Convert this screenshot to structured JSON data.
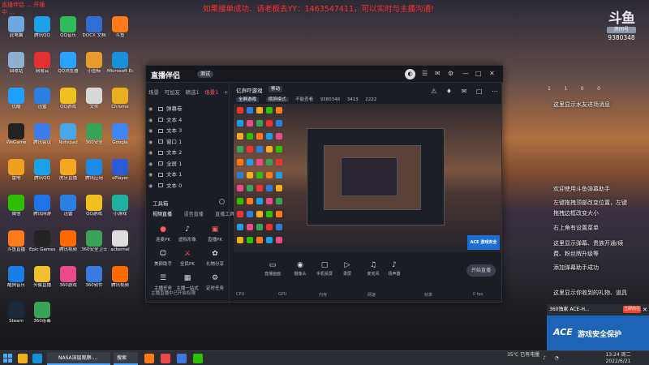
{
  "desktop_notice": "如果搜单成功、请老板去YY：1463547411，可以实时与主播沟通!",
  "corner_overlay_text": "直播伴侣 ... 开播中 ...",
  "douyu_badge": {
    "logo": "斗鱼",
    "sub": "房间号",
    "room": "9380348"
  },
  "desktop_icons": [
    {
      "label": "此电脑",
      "color": "#6fa8e0"
    },
    {
      "label": "腾讯QQ",
      "color": "#1aa1e8"
    },
    {
      "label": "QQ音乐",
      "color": "#2dbb5e"
    },
    {
      "label": "DOCX 文档",
      "color": "#2f6fd1"
    },
    {
      "label": "斗鱼",
      "color": "#ff7a1a"
    },
    {
      "label": "回收站",
      "color": "#8fb0d0"
    },
    {
      "label": "网易云",
      "color": "#e33030"
    },
    {
      "label": "QQ浏览器",
      "color": "#29a3ff"
    },
    {
      "label": "小图标",
      "color": "#e89a2c"
    },
    {
      "label": "Microsoft Edge",
      "color": "#1690d8"
    },
    {
      "label": "优酷",
      "color": "#1fa0ff"
    },
    {
      "label": "迅雷",
      "color": "#2a7fe0"
    },
    {
      "label": "QQ游戏",
      "color": "#f0c020"
    },
    {
      "label": "文件",
      "color": "#d8d8d8"
    },
    {
      "label": "Chrome",
      "color": "#e8b020"
    },
    {
      "label": "WeGame",
      "color": "#222222"
    },
    {
      "label": "腾讯会议",
      "color": "#3b7bea"
    },
    {
      "label": "Notepad",
      "color": "#49a8e8"
    },
    {
      "label": "360安全",
      "color": "#3aa35a"
    },
    {
      "label": "Google",
      "color": "#4285f4"
    },
    {
      "label": "雷电",
      "color": "#f0a020"
    },
    {
      "label": "腾讯QQ",
      "color": "#1aa1e8"
    },
    {
      "label": "虎牙直播",
      "color": "#f5a623"
    },
    {
      "label": "腾讯应用",
      "color": "#1b8ae8"
    },
    {
      "label": "xPlayer",
      "color": "#2a5bd7"
    },
    {
      "label": "微信",
      "color": "#2dc100"
    },
    {
      "label": "腾讯网游",
      "color": "#1d74e8"
    },
    {
      "label": "迅雷",
      "color": "#2a7fe0"
    },
    {
      "label": "QQ游戏",
      "color": "#f0c020"
    },
    {
      "label": "小游戏",
      "color": "#20b0a0"
    },
    {
      "label": "斗鱼直播",
      "color": "#ff7a1a"
    },
    {
      "label": "Epic Games",
      "color": "#222222"
    },
    {
      "label": "腾讯视频",
      "color": "#ff6a00"
    },
    {
      "label": "360安全卫士",
      "color": "#3aa35a"
    },
    {
      "label": "ackernel",
      "color": "#dddddd"
    },
    {
      "label": "酷狗音乐",
      "color": "#1a7de8"
    },
    {
      "label": "头像直播",
      "color": "#f0c030"
    },
    {
      "label": "360游戏",
      "color": "#e84a8a"
    },
    {
      "label": "360软件",
      "color": "#3a7ae0"
    },
    {
      "label": "腾讯视频",
      "color": "#ff6a00"
    },
    {
      "label": "Steam",
      "color": "#1b2838"
    },
    {
      "label": "360杀毒",
      "color": "#3aa35a"
    }
  ],
  "app": {
    "brand": "直播伴侣",
    "version": "测试",
    "avatar": "◐",
    "scene_tabs": [
      "场景",
      "可加友",
      "精选1",
      "场景1",
      "+"
    ],
    "sources": [
      "弹幕卷",
      "文本 4",
      "文本 3",
      "窗口 1",
      "文本 2",
      "全屏 1",
      "文本 1",
      "文本 0"
    ],
    "tools_title": "工具箱",
    "tool_tabs": [
      "视频直播",
      "语音直播",
      "直播工具"
    ],
    "tools_row1": [
      {
        "icon": "●",
        "label": "连麦PK",
        "color": "#ff5c5c"
      },
      {
        "icon": "♪",
        "label": "虚拟形象",
        "color": "#ddd"
      },
      {
        "icon": "▣",
        "label": "直播PK",
        "color": "#ff5c5c"
      }
    ],
    "tools_row2": [
      {
        "icon": "☺",
        "label": "美颜助手",
        "color": "#ddd"
      },
      {
        "icon": "⚔",
        "label": "全民PK",
        "color": "#ff5c5c"
      },
      {
        "icon": "✿",
        "label": "礼物分享",
        "color": "#ddd"
      }
    ],
    "tools_row3": [
      {
        "icon": "☰",
        "label": "主播任务",
        "color": "#ddd"
      },
      {
        "icon": "▦",
        "label": "主播一站式",
        "color": "#ddd"
      },
      {
        "icon": "⚙",
        "label": "定时任务",
        "color": "#ddd"
      }
    ],
    "left_footer": "主播直播中已开启权限",
    "center_title": "亿声吓游戏",
    "center_tag": "移动",
    "center_row2": [
      "全屏游戏",
      "横屏模式",
      "不能查看",
      "9380348",
      "3413",
      "2222"
    ],
    "center_icons": [
      "⚠",
      "♦",
      "✉",
      "□",
      "⋯"
    ],
    "preview_banner": "ACE 游戏安全",
    "toolbar": [
      {
        "icon": "▭",
        "label": "直播画面"
      },
      {
        "icon": "◉",
        "label": "摄像头"
      },
      {
        "icon": "▢",
        "label": "手机投屏"
      },
      {
        "icon": "▷",
        "label": "录屏"
      },
      {
        "icon": "♫",
        "label": "麦克风"
      },
      {
        "icon": "♪",
        "label": "扬声器"
      }
    ],
    "start_label": "开始直播",
    "status": [
      "CPU",
      "GPU",
      "内存",
      "网速",
      "帧率",
      "0 fps"
    ]
  },
  "chat": {
    "stats": [
      "1",
      "1",
      "0",
      "0"
    ],
    "messages": [
      "这里显示水友进场消息",
      "欢迎使用斗鱼弹幕助手",
      "左键拖拽顶部改变位置，左键",
      "拖拽边框改变大小",
      "右上角有设置菜单",
      "这里显示弹幕、贵族开通/续",
      "费、粉丝牌升级等",
      "添加弹幕助手成功",
      "这里显示你收到的礼物、道具"
    ]
  },
  "ace": {
    "title": "360独家  ACE-H...",
    "btn": "立即前往",
    "logo": "ACE",
    "text": "游戏安全保护"
  },
  "taskbar": {
    "window_label": "NASA深层观察-...",
    "window2": "搜索",
    "weather": "35℃ 已有电量",
    "time": "13:24 周二",
    "date": "2022/6/21"
  }
}
